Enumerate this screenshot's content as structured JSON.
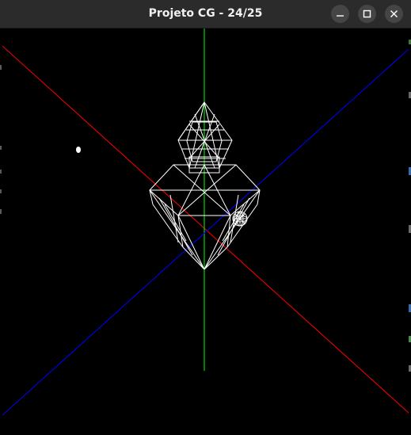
{
  "window": {
    "title": "Projeto CG - 24/25"
  },
  "controls": {
    "minimize_icon": "minimize-icon",
    "maximize_icon": "maximize-icon",
    "close_icon": "close-icon"
  },
  "scene": {
    "background": "#000000",
    "axis_colors": {
      "x": "#ff0000",
      "y": "#00ff00",
      "z": "#0000ff"
    },
    "wireframe_color": "#ffffff",
    "render_mode": "wireframe"
  }
}
